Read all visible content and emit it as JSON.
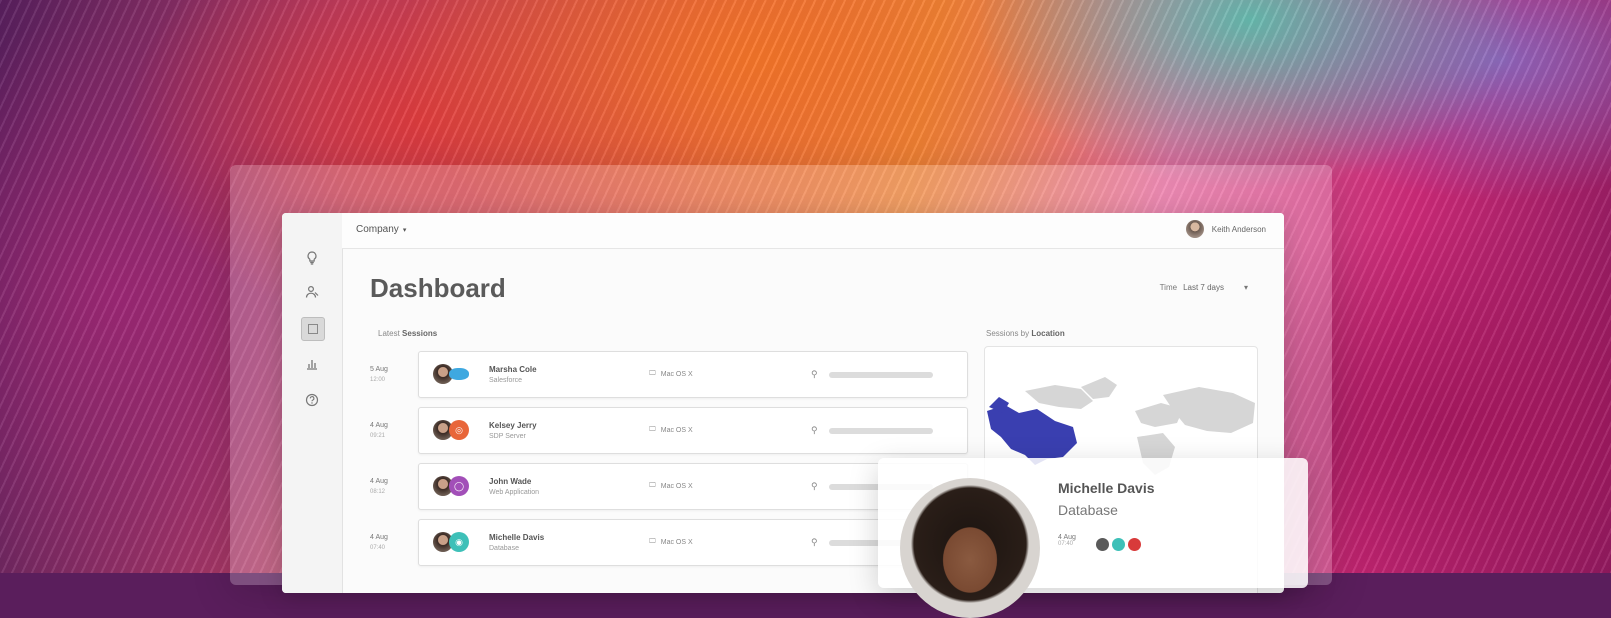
{
  "header": {
    "company_label": "Company",
    "user_name": "Keith Anderson"
  },
  "page": {
    "title": "Dashboard",
    "time_label": "Time",
    "time_value": "Last 7 days"
  },
  "sections": {
    "latest_prefix": "Latest",
    "latest_bold": "Sessions",
    "location_prefix": "Sessions by",
    "location_bold": "Location"
  },
  "sidebar": {
    "icons": [
      "lightbulb-icon",
      "users-icon",
      "dashboard-icon",
      "chart-icon",
      "help-icon"
    ]
  },
  "sessions": [
    {
      "date": "5 Aug",
      "time": "12:00",
      "name": "Marsha Cole",
      "role": "Salesforce",
      "os": "Mac OS X",
      "app_icon": "cloud-icon",
      "app_color": "#3ea8e0"
    },
    {
      "date": "4 Aug",
      "time": "09:21",
      "name": "Kelsey Jerry",
      "role": "SDP Server",
      "os": "Mac OS X",
      "app_icon": "server-icon",
      "app_color": "#e8663a"
    },
    {
      "date": "4 Aug",
      "time": "08:12",
      "name": "John Wade",
      "role": "Web Application",
      "os": "Mac OS X",
      "app_icon": "globe-icon",
      "app_color": "#a24fb8"
    },
    {
      "date": "4 Aug",
      "time": "07:40",
      "name": "Michelle Davis",
      "role": "Database",
      "os": "Mac OS X",
      "app_icon": "database-icon",
      "app_color": "#3ec0b8"
    }
  ],
  "profile": {
    "name": "Michelle Davis",
    "role": "Database",
    "date": "4 Aug",
    "time": "07:40"
  },
  "colors": {
    "map_highlight": "#3a3fb0",
    "map_land": "#d6d6d6"
  }
}
